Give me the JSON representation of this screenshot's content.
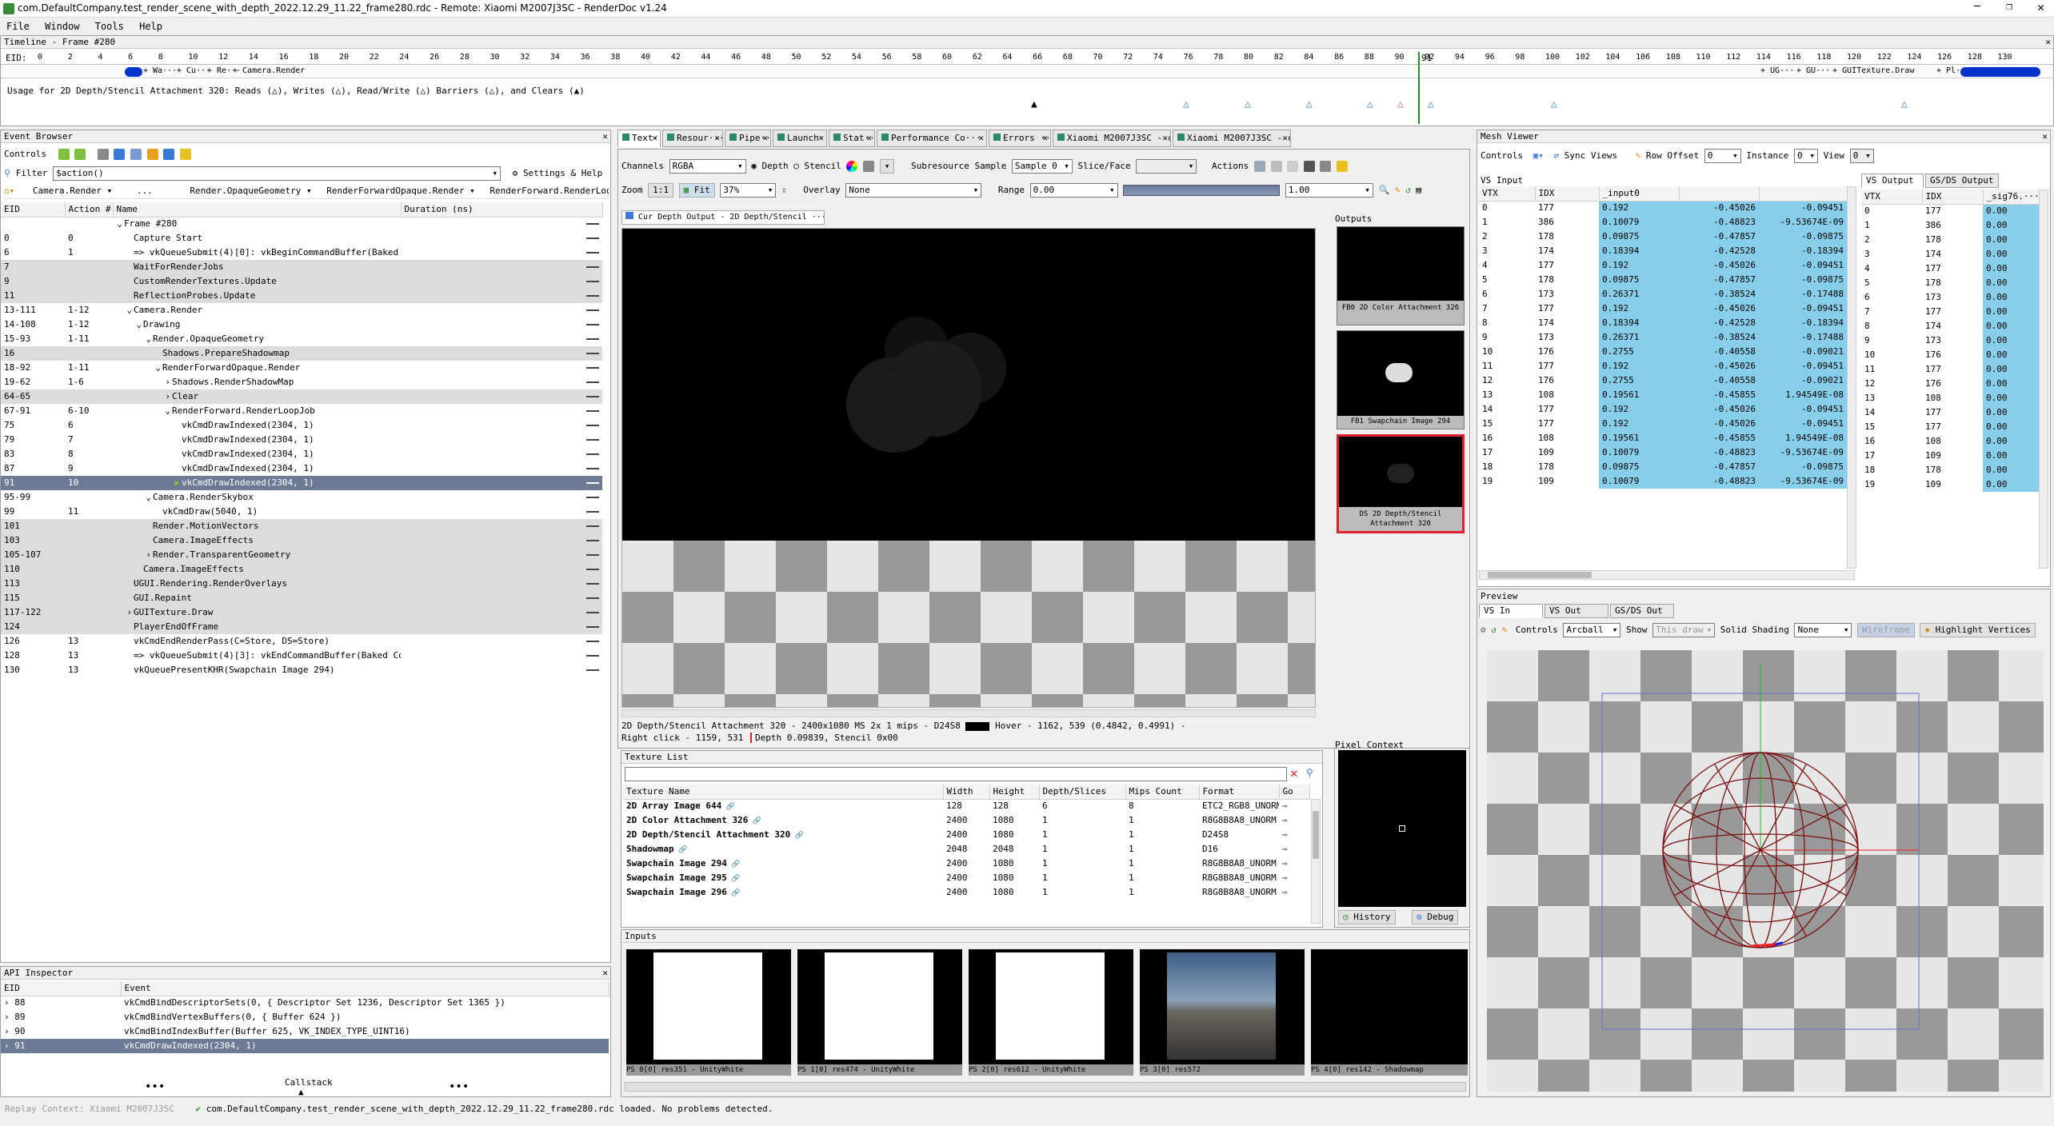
{
  "window": {
    "title": "com.DefaultCompany.test_render_scene_with_depth_2022.12.29_11.22_frame280.rdc - Remote: Xiaomi M2007J3SC - RenderDoc v1.24"
  },
  "menu": [
    "File",
    "Window",
    "Tools",
    "Help"
  ],
  "timeline": {
    "title": "Timeline - Frame #280",
    "eid_label": "EID:",
    "ticks": [
      "0",
      "2",
      "4",
      "6",
      "8",
      "10",
      "12",
      "14",
      "16",
      "18",
      "20",
      "22",
      "24",
      "26",
      "28",
      "30",
      "32",
      "34",
      "36",
      "38",
      "40",
      "42",
      "44",
      "46",
      "48",
      "50",
      "52",
      "54",
      "56",
      "58",
      "60",
      "62",
      "64",
      "66",
      "68",
      "70",
      "72",
      "74",
      "76",
      "78",
      "80",
      "82",
      "84",
      "86",
      "88",
      "90",
      "92",
      "94",
      "96",
      "98",
      "100",
      "102",
      "104",
      "106",
      "108",
      "110",
      "112",
      "114",
      "116",
      "118",
      "120",
      "122",
      "124",
      "126",
      "128",
      "130"
    ],
    "current": "91",
    "markers_row": [
      "+ Wa···",
      "+ Cu···",
      "+ Re···",
      "+ Camera.Render",
      "+ UG···",
      "+ GU···",
      "+ GUITexture.Draw",
      "+ Pl···"
    ],
    "usage": "Usage for 2D Depth/Stencil Attachment 320: Reads (△), Writes (△), Read/Write (△) Barriers (△), and Clears (▲)"
  },
  "event_browser": {
    "title": "Event Browser",
    "controls_label": "Controls",
    "filter_label": "Filter",
    "filter_value": "$action()",
    "settings_label": "Settings & Help",
    "breadcrumbs": [
      "Camera.Render",
      "...",
      "Render.OpaqueGeometry",
      "RenderForwardOpaque.Render",
      "RenderForward.RenderLoopJob"
    ],
    "columns": [
      "EID",
      "Action #",
      "Name",
      "Duration (ns)"
    ],
    "rows": [
      {
        "eid": "",
        "act": "",
        "name": "Frame #280",
        "ind": 0,
        "arrow": "v"
      },
      {
        "eid": "0",
        "act": "0",
        "name": "Capture Start",
        "ind": 1
      },
      {
        "eid": "6",
        "act": "1",
        "name": "=> vkQueueSubmit(4)[0]:  vkBeginCommandBuffer(Baked C",
        "ind": 1
      },
      {
        "eid": "7",
        "act": "",
        "name": "WaitForRenderJobs",
        "ind": 1,
        "hl": 1
      },
      {
        "eid": "9",
        "act": "",
        "name": "CustomRenderTextures.Update",
        "ind": 1,
        "hl": 1
      },
      {
        "eid": "11",
        "act": "",
        "name": "ReflectionProbes.Update",
        "ind": 1,
        "hl": 1
      },
      {
        "eid": "13-111",
        "act": "1-12",
        "name": "Camera.Render",
        "ind": 1,
        "arrow": "v"
      },
      {
        "eid": "14-108",
        "act": "1-12",
        "name": "Drawing",
        "ind": 2,
        "arrow": "v"
      },
      {
        "eid": "15-93",
        "act": "1-11",
        "name": "Render.OpaqueGeometry",
        "ind": 3,
        "arrow": "v"
      },
      {
        "eid": "16",
        "act": "",
        "name": "Shadows.PrepareShadowmap",
        "ind": 4,
        "hl": 1
      },
      {
        "eid": "18-92",
        "act": "1-11",
        "name": "RenderForwardOpaque.Render",
        "ind": 4,
        "arrow": "v"
      },
      {
        "eid": "19-62",
        "act": "1-6",
        "name": "Shadows.RenderShadowMap",
        "ind": 5,
        "arrow": ">"
      },
      {
        "eid": "64-65",
        "act": "",
        "name": "Clear",
        "ind": 5,
        "arrow": ">",
        "hl": 1
      },
      {
        "eid": "67-91",
        "act": "6-10",
        "name": "RenderForward.RenderLoopJob",
        "ind": 5,
        "arrow": "v"
      },
      {
        "eid": "75",
        "act": "6",
        "name": "vkCmdDrawIndexed(2304, 1)",
        "ind": 6
      },
      {
        "eid": "79",
        "act": "7",
        "name": "vkCmdDrawIndexed(2304, 1)",
        "ind": 6
      },
      {
        "eid": "83",
        "act": "8",
        "name": "vkCmdDrawIndexed(2304, 1)",
        "ind": 6
      },
      {
        "eid": "87",
        "act": "9",
        "name": "vkCmdDrawIndexed(2304, 1)",
        "ind": 6
      },
      {
        "eid": "91",
        "act": "10",
        "name": "vkCmdDrawIndexed(2304, 1)",
        "ind": 6,
        "sel": 1
      },
      {
        "eid": "95-99",
        "act": "",
        "name": "Camera.RenderSkybox",
        "ind": 3,
        "arrow": "v"
      },
      {
        "eid": "99",
        "act": "11",
        "name": "vkCmdDraw(5040, 1)",
        "ind": 4
      },
      {
        "eid": "101",
        "act": "",
        "name": "Render.MotionVectors",
        "ind": 3,
        "hl": 1
      },
      {
        "eid": "103",
        "act": "",
        "name": "Camera.ImageEffects",
        "ind": 3,
        "hl": 1
      },
      {
        "eid": "105-107",
        "act": "",
        "name": "Render.TransparentGeometry",
        "ind": 3,
        "arrow": ">",
        "hl": 1
      },
      {
        "eid": "110",
        "act": "",
        "name": "Camera.ImageEffects",
        "ind": 2,
        "hl": 1
      },
      {
        "eid": "113",
        "act": "",
        "name": "UGUI.Rendering.RenderOverlays",
        "ind": 1,
        "hl": 1
      },
      {
        "eid": "115",
        "act": "",
        "name": "GUI.Repaint",
        "ind": 1,
        "hl": 1
      },
      {
        "eid": "117-122",
        "act": "",
        "name": "GUITexture.Draw",
        "ind": 1,
        "arrow": ">",
        "hl": 1
      },
      {
        "eid": "124",
        "act": "",
        "name": "PlayerEndOfFrame",
        "ind": 1,
        "hl": 1
      },
      {
        "eid": "126",
        "act": "13",
        "name": "vkCmdEndRenderPass(C=Store, DS=Store)",
        "ind": 1
      },
      {
        "eid": "128",
        "act": "13",
        "name": "=> vkQueueSubmit(4)[3]:  vkEndCommandBuffer(Baked Co",
        "ind": 1
      },
      {
        "eid": "130",
        "act": "13",
        "name": "vkQueuePresentKHR(Swapchain Image 294)",
        "ind": 1
      }
    ]
  },
  "api_inspector": {
    "title": "API Inspector",
    "columns": [
      "EID",
      "Event"
    ],
    "rows": [
      {
        "eid": "88",
        "event": "vkCmdBindDescriptorSets(0, { Descriptor Set 1236, Descriptor Set 1365 })"
      },
      {
        "eid": "89",
        "event": "vkCmdBindVertexBuffers(0, { Buffer 624 })"
      },
      {
        "eid": "90",
        "event": "vkCmdBindIndexBuffer(Buffer 625, VK_INDEX_TYPE_UINT16)"
      },
      {
        "eid": "91",
        "event": "vkCmdDrawIndexed(2304, 1)",
        "sel": 1
      }
    ],
    "callstack": "Callstack"
  },
  "status": {
    "replay": "Replay Context: Xiaomi M2007J3SC",
    "message": "com.DefaultCompany.test_render_scene_with_depth_2022.12.29_11.22_frame280.rdc loaded. No problems detected."
  },
  "texture_viewer": {
    "tabs": [
      "Text···",
      "Resour···",
      "Pipe···",
      "Launch···",
      "Stat···",
      "Performance Co···",
      "Errors ···",
      "Xiaomi M2007J3SC - com···",
      "Xiaomi M2007J3SC - com···"
    ],
    "channels_label": "Channels",
    "channels_value": "RGBA",
    "depth_label": "Depth",
    "stencil_label": "Stencil",
    "subresource_label": "Subresource",
    "sample_label": "Sample",
    "sample_value": "Sample 0",
    "slice_label": "Slice/Face",
    "actions_label": "Actions",
    "zoom_label": "Zoom",
    "zoom_11": "1:1",
    "fit_label": "Fit",
    "zoom_value": "37%",
    "overlay_label": "Overlay",
    "overlay_value": "None",
    "range_label": "Range",
    "range_min": "0.00",
    "range_max": "1.00",
    "view_tab": "Cur Depth Output - 2D Depth/Stencil ···",
    "info": "2D Depth/Stencil Attachment 320 - 2400x1080 MS 2x 1 mips - D24S8",
    "hover": "Hover -  1162,  539 (0.4842, 0.4991)  -",
    "rightclick": "Right click - 1159,  531",
    "depth_readout": "Depth 0.09839, Stencil 0x00",
    "outputs_label": "Outputs",
    "outputs": [
      "FB0  2D Color Attachment 326",
      "FB1  Swapchain Image 294",
      "DS  2D Depth/Stencil Attachment 320"
    ],
    "pixel_context": "Pixel Context",
    "history_btn": "History",
    "debug_btn": "Debug"
  },
  "texture_list": {
    "title": "Texture List",
    "columns": [
      "Texture Name",
      "Width",
      "Height",
      "Depth/Slices",
      "Mips Count",
      "Format",
      "Go"
    ],
    "rows": [
      [
        "2D Array Image 644",
        "128",
        "128",
        "6",
        "8",
        "ETC2_RGB8_UNORM"
      ],
      [
        "2D Color Attachment 326",
        "2400",
        "1080",
        "1",
        "1",
        "R8G8B8A8_UNORM"
      ],
      [
        "2D Depth/Stencil Attachment 320",
        "2400",
        "1080",
        "1",
        "1",
        "D24S8"
      ],
      [
        "Shadowmap",
        "2048",
        "2048",
        "1",
        "1",
        "D16"
      ],
      [
        "Swapchain Image 294",
        "2400",
        "1080",
        "1",
        "1",
        "R8G8B8A8_UNORM"
      ],
      [
        "Swapchain Image 295",
        "2400",
        "1080",
        "1",
        "1",
        "R8G8B8A8_UNORM"
      ],
      [
        "Swapchain Image 296",
        "2400",
        "1080",
        "1",
        "1",
        "R8G8B8A8_UNORM"
      ]
    ]
  },
  "inputs": {
    "title": "Inputs",
    "thumbs": [
      "PS 0[0]    res351 - UnityWhite",
      "PS 1[0]    res474 - UnityWhite",
      "PS 2[0]    res612 - UnityWhite",
      "PS 3[0]         res572",
      "PS 4[0]    res142 - Shadowmap"
    ]
  },
  "mesh_viewer": {
    "title": "Mesh Viewer",
    "controls_label": "Controls",
    "sync_label": "Sync Views",
    "row_offset_label": "Row Offset",
    "row_offset": "0",
    "instance_label": "Instance",
    "instance": "0",
    "view_label": "View",
    "view": "0",
    "vs_input_label": "VS Input",
    "input_columns": [
      "VTX",
      "IDX",
      "_input0",
      "",
      ""
    ],
    "input_rows": [
      [
        "0",
        "177",
        "0.192",
        "-0.45026",
        "-0.09451"
      ],
      [
        "1",
        "386",
        "0.10079",
        "-0.48823",
        "-9.53674E-09"
      ],
      [
        "2",
        "178",
        "0.09875",
        "-0.47857",
        "-0.09875"
      ],
      [
        "3",
        "174",
        "0.18394",
        "-0.42528",
        "-0.18394"
      ],
      [
        "4",
        "177",
        "0.192",
        "-0.45026",
        "-0.09451"
      ],
      [
        "5",
        "178",
        "0.09875",
        "-0.47857",
        "-0.09875"
      ],
      [
        "6",
        "173",
        "0.26371",
        "-0.38524",
        "-0.17488"
      ],
      [
        "7",
        "177",
        "0.192",
        "-0.45026",
        "-0.09451"
      ],
      [
        "8",
        "174",
        "0.18394",
        "-0.42528",
        "-0.18394"
      ],
      [
        "9",
        "173",
        "0.26371",
        "-0.38524",
        "-0.17488"
      ],
      [
        "10",
        "176",
        "0.2755",
        "-0.40558",
        "-0.09021"
      ],
      [
        "11",
        "177",
        "0.192",
        "-0.45026",
        "-0.09451"
      ],
      [
        "12",
        "176",
        "0.2755",
        "-0.40558",
        "-0.09021"
      ],
      [
        "13",
        "108",
        "0.19561",
        "-0.45855",
        "1.94549E-08"
      ],
      [
        "14",
        "177",
        "0.192",
        "-0.45026",
        "-0.09451"
      ],
      [
        "15",
        "177",
        "0.192",
        "-0.45026",
        "-0.09451"
      ],
      [
        "16",
        "108",
        "0.19561",
        "-0.45855",
        "1.94549E-08"
      ],
      [
        "17",
        "109",
        "0.10079",
        "-0.48823",
        "-9.53674E-09"
      ],
      [
        "18",
        "178",
        "0.09875",
        "-0.47857",
        "-0.09875"
      ],
      [
        "19",
        "109",
        "0.10079",
        "-0.48823",
        "-9.53674E-09"
      ]
    ],
    "vs_output_tab": "VS Output",
    "gs_output_tab": "GS/DS Output",
    "output_columns": [
      "VTX",
      "IDX",
      "_sig76.···"
    ],
    "output_rows": [
      [
        "0",
        "177",
        "0.00"
      ],
      [
        "1",
        "386",
        "0.00"
      ],
      [
        "2",
        "178",
        "0.00"
      ],
      [
        "3",
        "174",
        "0.00"
      ],
      [
        "4",
        "177",
        "0.00"
      ],
      [
        "5",
        "178",
        "0.00"
      ],
      [
        "6",
        "173",
        "0.00"
      ],
      [
        "7",
        "177",
        "0.00"
      ],
      [
        "8",
        "174",
        "0.00"
      ],
      [
        "9",
        "173",
        "0.00"
      ],
      [
        "10",
        "176",
        "0.00"
      ],
      [
        "11",
        "177",
        "0.00"
      ],
      [
        "12",
        "176",
        "0.00"
      ],
      [
        "13",
        "108",
        "0.00"
      ],
      [
        "14",
        "177",
        "0.00"
      ],
      [
        "15",
        "177",
        "0.00"
      ],
      [
        "16",
        "108",
        "0.00"
      ],
      [
        "17",
        "109",
        "0.00"
      ],
      [
        "18",
        "178",
        "0.00"
      ],
      [
        "19",
        "109",
        "0.00"
      ]
    ],
    "preview_label": "Preview",
    "preview_tabs": [
      "VS In",
      "VS Out",
      "GS/DS Out"
    ],
    "controls_value": "Arcball",
    "show_label": "Show",
    "show_value": "This draw",
    "shading_label": "Solid Shading",
    "shading_value": "None",
    "wireframe_label": "Wireframe",
    "highlight_label": "Highlight Vertices"
  },
  "colors": {
    "accent": "#87ceeb",
    "selection": "#6d7a96",
    "highlight_red": "#e0202a",
    "wire": "#7a1010"
  }
}
